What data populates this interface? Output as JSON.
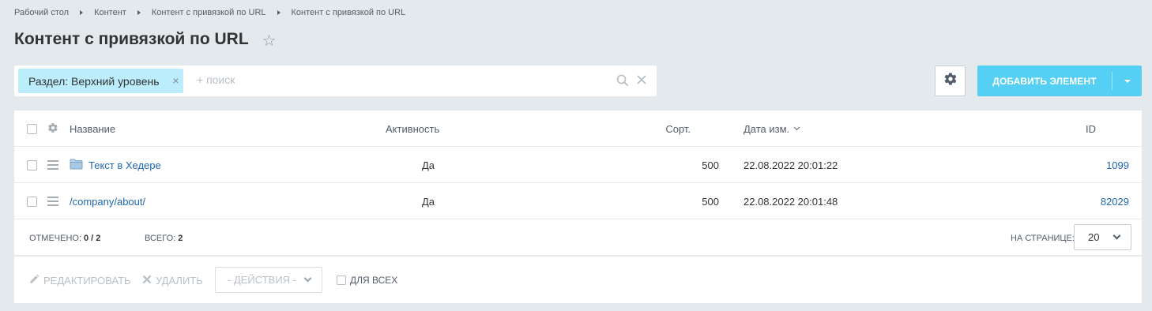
{
  "breadcrumbs": [
    "Рабочий стол",
    "Контент",
    "Контент с привязкой по URL",
    "Контент с привязкой по URL"
  ],
  "page_title": "Контент с привязкой по URL",
  "filter": {
    "tag_label": "Раздел: Верхний уровень",
    "tag_close": "×",
    "placeholder": "+ поиск"
  },
  "toolbar": {
    "add_label": "ДОБАВИТЬ ЭЛЕМЕНТ"
  },
  "grid": {
    "columns": {
      "name": "Название",
      "active": "Активность",
      "sort": "Сорт.",
      "date": "Дата изм.",
      "id": "ID"
    },
    "rows": [
      {
        "name": "Текст в Хедере",
        "is_folder": true,
        "active": "Да",
        "sort": "500",
        "date": "22.08.2022 20:01:22",
        "id": "1099"
      },
      {
        "name": "/company/about/",
        "is_folder": false,
        "active": "Да",
        "sort": "500",
        "date": "22.08.2022 20:01:48",
        "id": "82029"
      }
    ]
  },
  "footer": {
    "selected_label": "ОТМЕЧЕНО:",
    "selected_value": "0 / 2",
    "total_label": "ВСЕГО:",
    "total_value": "2",
    "per_page_label": "НА СТРАНИЦЕ:",
    "per_page_value": "20"
  },
  "actions": {
    "edit": "РЕДАКТИРОВАТЬ",
    "delete": "УДАЛИТЬ",
    "select_placeholder": "- ДЕЙСТВИЯ -",
    "for_all": "ДЛЯ ВСЕХ"
  },
  "colors": {
    "accent": "#55d0f4",
    "tag_bg": "#bcedfc",
    "link": "#2067b0",
    "page_bg": "#e3e9ec"
  },
  "icons": [
    "star-icon",
    "search-icon",
    "clear-icon",
    "gear-icon",
    "chevron-down-icon",
    "folder-icon",
    "drag-handle-icon",
    "pencil-icon",
    "delete-x-icon"
  ]
}
